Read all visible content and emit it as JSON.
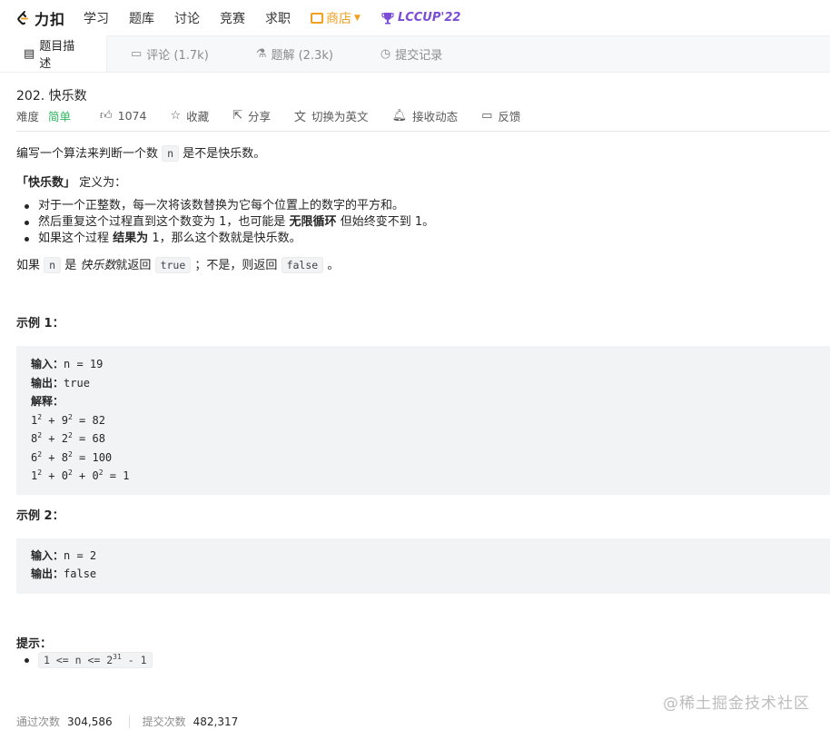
{
  "nav": {
    "logo": "力扣",
    "items": [
      "学习",
      "题库",
      "讨论",
      "竞赛",
      "求职"
    ],
    "store": "商店",
    "lccup": "LCCUP'22"
  },
  "tabs": [
    {
      "label": "题目描述",
      "icon": "doc-icon"
    },
    {
      "label": "评论 (1.7k)",
      "icon": "comment-icon"
    },
    {
      "label": "题解 (2.3k)",
      "icon": "flask-icon"
    },
    {
      "label": "提交记录",
      "icon": "history-icon"
    }
  ],
  "problem": {
    "title": "202. 快乐数",
    "difficulty_label": "难度",
    "difficulty": "简单",
    "likes": "1074",
    "favorite": "收藏",
    "share": "分享",
    "translate": "切换为英文",
    "notify": "接收动态",
    "feedback": "反馈"
  },
  "description": {
    "p1_before": "编写一个算法来判断一个数",
    "p1_code": "n",
    "p1_after": "是不是快乐数。",
    "p2_bold": "「快乐数」",
    "p2_after": "定义为：",
    "rule1": "对于一个正整数，每一次将该数替换为它每个位置上的数字的平方和。",
    "rule2_before": "然后重复这个过程直到这个数变为 1，也可能是",
    "rule2_bold": "无限循环",
    "rule2_after": "但始终变不到 1。",
    "rule3_before": "如果这个过程",
    "rule3_bold": "结果为",
    "rule3_after": "1，那么这个数就是快乐数。",
    "p3_a": "如果",
    "p3_code1": "n",
    "p3_b": "是",
    "p3_em": "快乐数",
    "p3_c": "就返回",
    "p3_code2": "true",
    "p3_d": "；不是，则返回",
    "p3_code3": "false",
    "p3_e": "。"
  },
  "example1": {
    "heading": "示例 1：",
    "input_label": "输入：",
    "input": "n = 19",
    "output_label": "输出：",
    "output": "true",
    "explain_label": "解释："
  },
  "example2": {
    "heading": "示例 2：",
    "input_label": "输入：",
    "input": "n = 2",
    "output_label": "输出：",
    "output": "false"
  },
  "hints": {
    "heading": "提示："
  },
  "stats": {
    "pass_label": "通过次数",
    "pass_value": "304,586",
    "submit_label": "提交次数",
    "submit_value": "482,317"
  },
  "watermark": "@稀土掘金技术社区"
}
